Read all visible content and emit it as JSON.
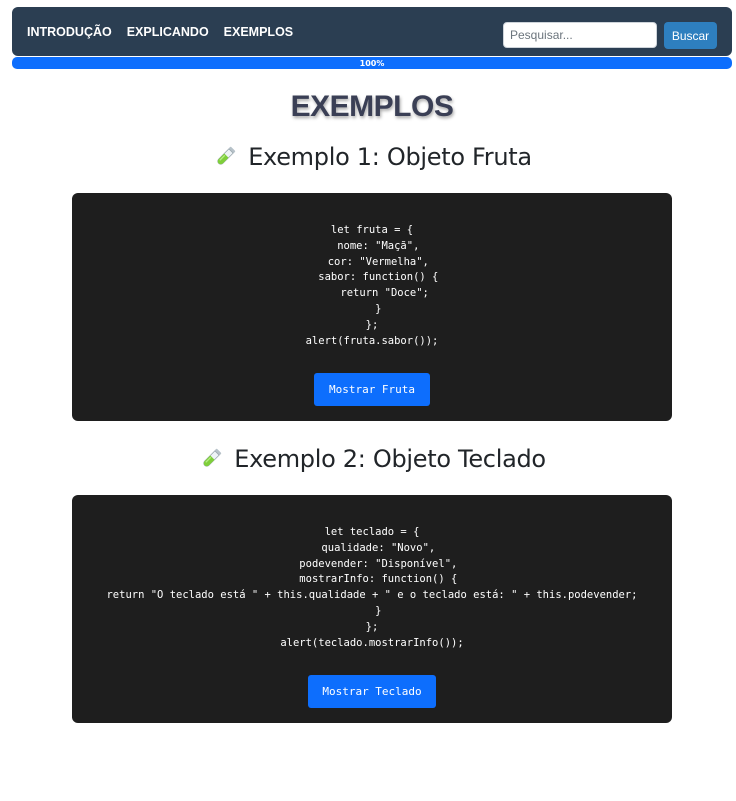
{
  "nav": {
    "links": [
      "INTRODUÇÃO",
      "EXPLICANDO",
      "EXEMPLOS"
    ],
    "search_placeholder": "Pesquisar...",
    "search_button": "Buscar"
  },
  "progress": {
    "value_percent": 100,
    "label": "100%",
    "color": "#0d6efd"
  },
  "page_title": "EXEMPLOS",
  "examples": [
    {
      "icon": "test-tube-icon",
      "title": "Exemplo 1: Objeto Fruta",
      "code": "let fruta = {\n  nome: \"Maçã\",\n  cor: \"Vermelha\",\n  sabor: function() {\n    return \"Doce\";\n  }\n};\nalert(fruta.sabor());",
      "button": "Mostrar Fruta"
    },
    {
      "icon": "test-tube-icon",
      "title": "Exemplo 2: Objeto Teclado",
      "code": "let teclado = {\n  qualidade: \"Novo\",\n  podevender: \"Disponível\",\n  mostrarInfo: function() {\nreturn \"O teclado está \" + this.qualidade + \" e o teclado está: \" + this.podevender;\n  }\n};\nalert(teclado.mostrarInfo());",
      "button": "Mostrar Teclado"
    }
  ],
  "colors": {
    "navbar": "#2b3e52",
    "code_background": "#1e1e1e",
    "primary_button": "#0d6efd",
    "search_button": "#2e7fbf"
  }
}
